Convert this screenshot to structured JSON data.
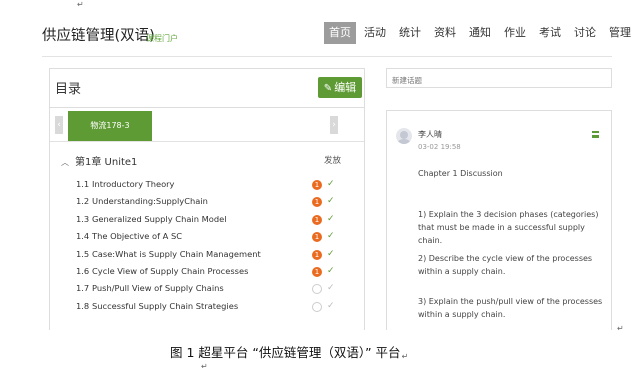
{
  "marks": {
    "return_symbol": "↵"
  },
  "header": {
    "course_title": "供应链管理(双语)",
    "course_subtitle": "课程门户",
    "nav": [
      "首页",
      "活动",
      "统计",
      "资料",
      "通知",
      "作业",
      "考试",
      "讨论",
      "管理"
    ],
    "active_nav": "首页"
  },
  "catalog": {
    "title": "目录",
    "edit_label": "编辑",
    "tab_label": "物流178-3",
    "chapter_title": "第1章 Unite1",
    "publish_label": "发放",
    "lessons": [
      {
        "num": "1.1",
        "title": "Introductory Theory",
        "status": "done"
      },
      {
        "num": "1.2",
        "title": "Understanding:SupplyChain",
        "status": "done"
      },
      {
        "num": "1.3",
        "title": "Generalized Supply Chain Model",
        "status": "done"
      },
      {
        "num": "1.4",
        "title": "The Objective of A SC",
        "status": "done"
      },
      {
        "num": "1.5",
        "title": "Case:What is Supply Chain Management",
        "status": "done"
      },
      {
        "num": "1.6",
        "title": "Cycle View of Supply Chain Processes",
        "status": "done"
      },
      {
        "num": "1.7",
        "title": "Push/Pull View of Supply Chains",
        "status": "empty"
      },
      {
        "num": "1.8",
        "title": "Successful Supply Chain Strategies",
        "status": "empty"
      }
    ],
    "status_done_glyph": "1",
    "check_glyph": "✓"
  },
  "discussion": {
    "new_topic_placeholder": "新建话题",
    "post": {
      "author": "李人晴",
      "time": "03-02 19:58",
      "title": "Chapter 1 Discussion",
      "q1": "1) Explain the 3 decision phases (categories) that must be made in a successful supply chain.",
      "q2": "2) Describe the cycle view of the processes within a supply chain.",
      "q3": "3) Explain the push/pull view of the processes within a supply chain."
    }
  },
  "caption": "图 1  超星平台 “供应链管理（双语）” 平台",
  "colors": {
    "accent_green": "#5f9b35",
    "status_orange": "#ea6b20",
    "nav_active_bg": "#9c9c9c"
  }
}
